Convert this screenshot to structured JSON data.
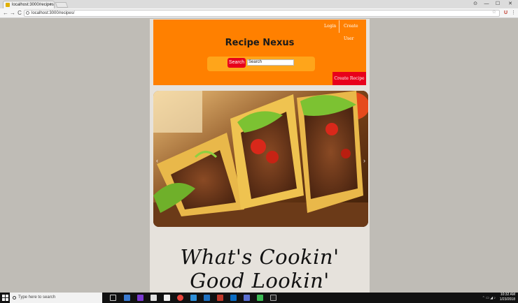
{
  "browser": {
    "tab_title": "localhost:3000/recipes",
    "url": "localhost:3000/recipes/",
    "tab_close": "×",
    "controls": {
      "profile": "⊙",
      "minimize": "—",
      "maximize": "☐",
      "close": "✕"
    },
    "nav": {
      "back": "←",
      "forward": "→",
      "reload": "C"
    }
  },
  "site": {
    "title": "Recipe Nexus",
    "nav": {
      "login": "Login",
      "create_user": "Create User"
    },
    "search": {
      "button": "Search",
      "value": "Search"
    },
    "create_recipe": "Create Recipe",
    "hero_image": "tacos-photo",
    "tagline": "What's Cookin' Good Lookin'",
    "carousel": {
      "prev": "‹",
      "next": "›"
    }
  },
  "taskbar": {
    "search_placeholder": "Type here to search",
    "time": "10:32 AM",
    "date": "1/23/2018"
  },
  "colors": {
    "header": "#ff8000",
    "accent_red": "#e8001a",
    "search_band": "#ffa51a"
  }
}
